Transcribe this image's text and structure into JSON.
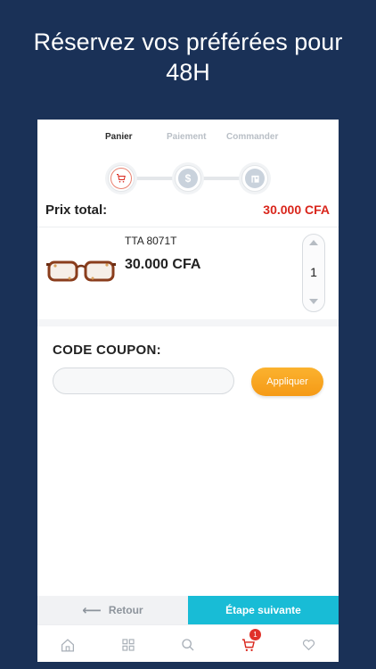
{
  "headline": {
    "line1": "Réservez vos préférées pour",
    "line2": "48H"
  },
  "stepper": {
    "steps": [
      {
        "label": "Panier",
        "icon": "cart-icon",
        "active": true
      },
      {
        "label": "Paiement",
        "icon": "dollar-icon",
        "active": false
      },
      {
        "label": "Commander",
        "icon": "store-icon",
        "active": false
      }
    ]
  },
  "cart": {
    "total_label": "Prix total:",
    "total_value": "30.000 CFA",
    "items": [
      {
        "reference": "TTA 8071T",
        "price": "30.000 CFA",
        "quantity": "1",
        "image": "tortoise-glasses"
      }
    ]
  },
  "coupon": {
    "title": "CODE COUPON:",
    "value": "",
    "placeholder": "",
    "apply_label": "Appliquer"
  },
  "actions": {
    "back_label": "Retour",
    "next_label": "Étape suivante"
  },
  "tabbar": {
    "items": [
      "home-icon",
      "grid-icon",
      "search-icon",
      "cart-icon",
      "heart-icon"
    ],
    "cart_badge": "1"
  },
  "colors": {
    "background": "#1a3157",
    "price_red": "#d9261c",
    "apply_orange": "#f9a825",
    "next_cyan": "#18bcd6"
  }
}
